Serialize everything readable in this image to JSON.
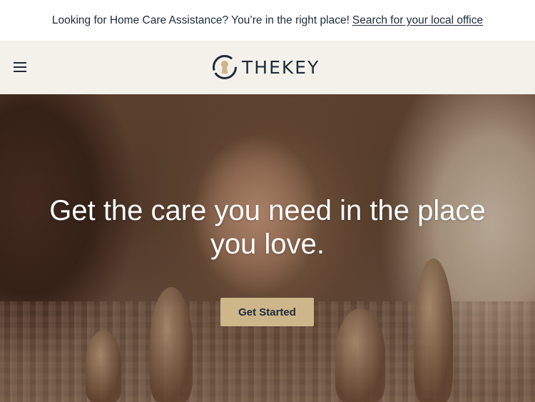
{
  "announcement": {
    "text": "Looking for Home Care Assistance? You’re in the right place!",
    "link_label": "Search for your local office"
  },
  "header": {
    "menu_icon": "hamburger-menu-icon",
    "logo_text": "THEKEY"
  },
  "hero": {
    "headline": "Get the care you need in the place you love.",
    "cta_label": "Get Started"
  },
  "colors": {
    "navy": "#1c2b3a",
    "cream": "#f4f1ea",
    "gold": "#cdb68a"
  }
}
